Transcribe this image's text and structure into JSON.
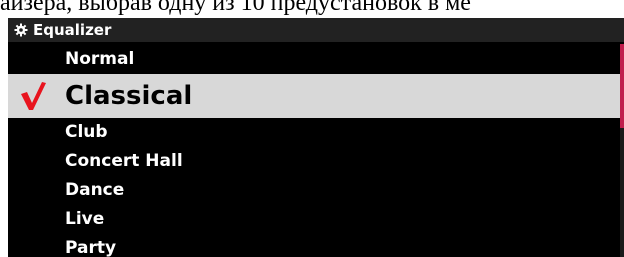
{
  "header_text": "айзера, выбрав одну из 10 предустановок в ме",
  "window": {
    "title": "Equalizer",
    "icon": "gear-icon"
  },
  "colors": {
    "accent": "#c01d4c",
    "check": "#e8141e",
    "selected_bg": "#d8d8d8"
  },
  "presets": {
    "items": [
      {
        "label": "Normal"
      },
      {
        "label": "Classical",
        "selected": true
      },
      {
        "label": "Club"
      },
      {
        "label": "Concert Hall"
      },
      {
        "label": "Dance"
      },
      {
        "label": "Live"
      },
      {
        "label": "Party"
      }
    ]
  }
}
